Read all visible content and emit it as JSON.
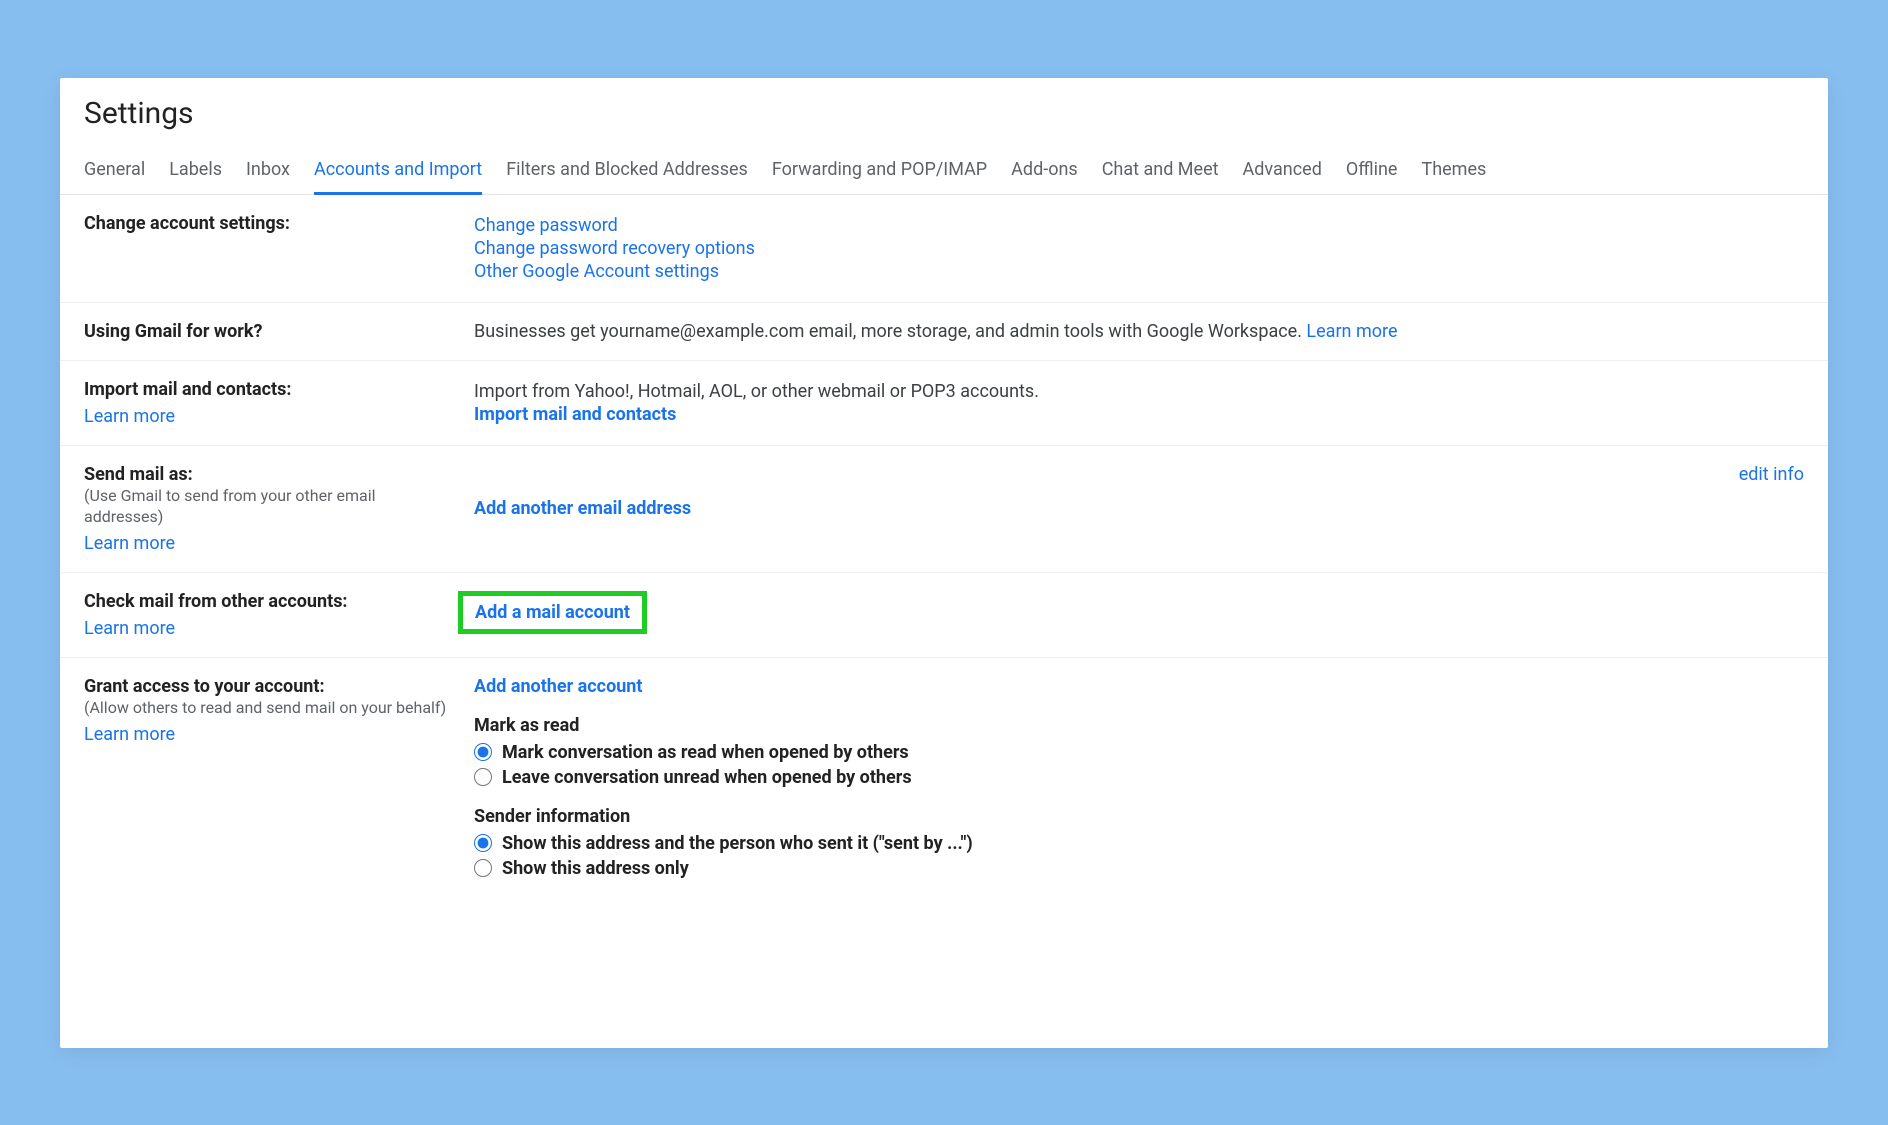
{
  "page_title": "Settings",
  "tabs": [
    "General",
    "Labels",
    "Inbox",
    "Accounts and Import",
    "Filters and Blocked Addresses",
    "Forwarding and POP/IMAP",
    "Add-ons",
    "Chat and Meet",
    "Advanced",
    "Offline",
    "Themes"
  ],
  "active_tab_index": 3,
  "learn_more": "Learn more",
  "change_account": {
    "title": "Change account settings:",
    "links": [
      "Change password",
      "Change password recovery options",
      "Other Google Account settings"
    ]
  },
  "using_for_work": {
    "title": "Using Gmail for work?",
    "text": "Businesses get yourname@example.com email, more storage, and admin tools with Google Workspace. ",
    "learn": "Learn more"
  },
  "import_mail": {
    "title": "Import mail and contacts:",
    "desc": "Import from Yahoo!, Hotmail, AOL, or other webmail or POP3 accounts.",
    "action": "Import mail and contacts"
  },
  "send_mail_as": {
    "title": "Send mail as:",
    "sub": "(Use Gmail to send from your other email addresses)",
    "action": "Add another email address",
    "edit": "edit info"
  },
  "check_mail": {
    "title": "Check mail from other accounts:",
    "action": "Add a mail account"
  },
  "grant_access": {
    "title": "Grant access to your account:",
    "sub": "(Allow others to read and send mail on your behalf)",
    "action": "Add another account",
    "mark_title": "Mark as read",
    "mark_opts": [
      "Mark conversation as read when opened by others",
      "Leave conversation unread when opened by others"
    ],
    "sender_title": "Sender information",
    "sender_opts": [
      "Show this address and the person who sent it (\"sent by ...\")",
      "Show this address only"
    ]
  }
}
